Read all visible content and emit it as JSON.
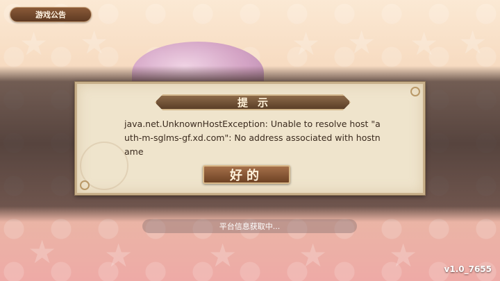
{
  "notice_tab": {
    "label": "游戏公告"
  },
  "dialog": {
    "title": "提示",
    "message": "java.net.UnknownHostException: Unable to resolve host \"auth-m-sglms-gf.xd.com\": No address associated with hostname",
    "ok_label": "好的"
  },
  "status": {
    "text": "平台信息获取中..."
  },
  "version": "v1.0_7655",
  "colors": {
    "dialog_bg": "#efe4cc",
    "button_brown": "#8a5a36",
    "title_brown": "#6f4f33"
  }
}
